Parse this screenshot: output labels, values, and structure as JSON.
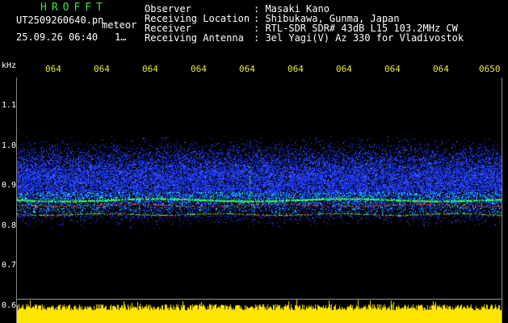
{
  "header": {
    "brand": "HROFFT",
    "filename": "UT2509260640.pn",
    "mode_label": "meteor",
    "timestamp": "25.09.26 06:40",
    "page_marker": "1…"
  },
  "station_info": [
    {
      "label": "Observer",
      "value": ": Masaki Kano"
    },
    {
      "label": "Receiving Location",
      "value": ": Shibukawa, Gunma, Japan"
    },
    {
      "label": "Receiver",
      "value": ": RTL-SDR SDR# 43dB L15 103.2MHz CW"
    },
    {
      "label": "Receiving Antenna",
      "value": ": 3el Yagi(V) Az 330 for Vladivostok"
    }
  ],
  "spectrogram": {
    "unit_label": "kHz",
    "time_labels": [
      "064",
      "064",
      "064",
      "064",
      "064",
      "064",
      "064",
      "064",
      "064",
      "0650"
    ],
    "freq_labels": [
      "1.1",
      "1.0",
      "0.9",
      "0.8",
      "0.7",
      "0.6"
    ],
    "colors": {
      "background": "#000000",
      "noise_blue": "#1f3cff",
      "signal_cyan": "#23e0ff",
      "signal_green": "#3cff3c",
      "signal_red": "#ff2a2a",
      "floor_yellow": "#ffe600",
      "label_yellow": "#e8e83a",
      "brand_green": "#39e63c"
    }
  }
}
